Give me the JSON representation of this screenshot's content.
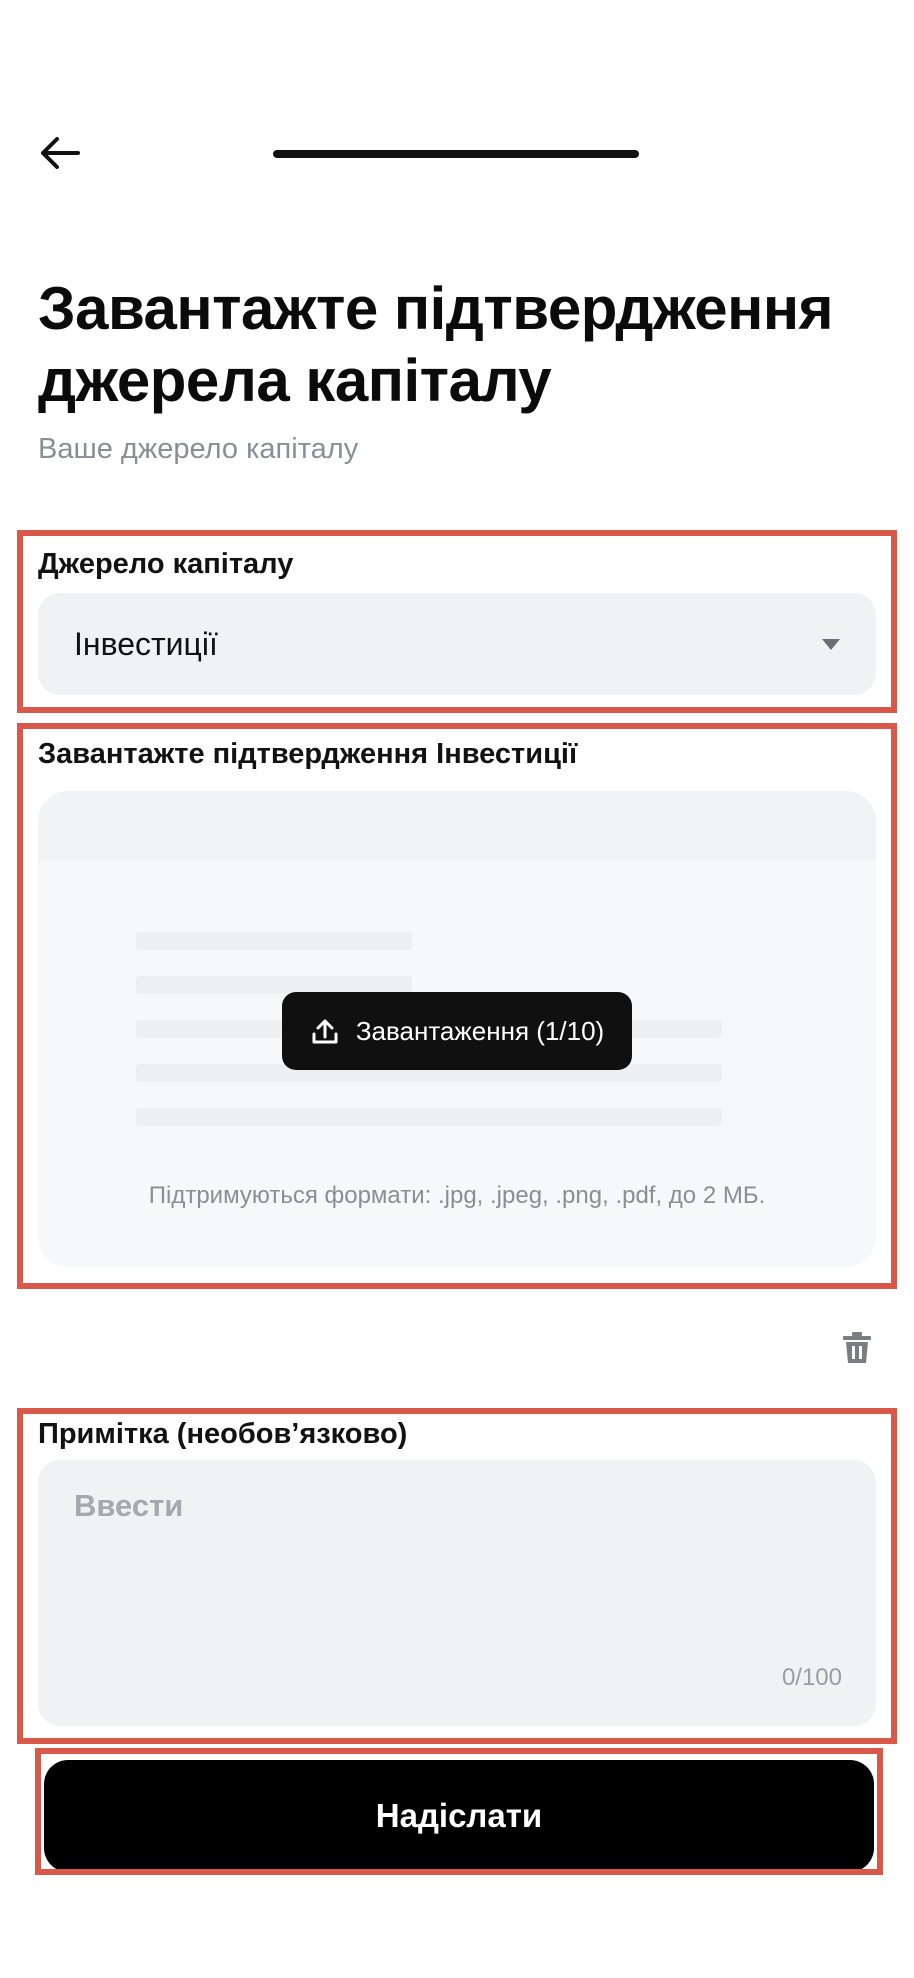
{
  "header": {
    "back_icon": "arrow-left-icon"
  },
  "title": "Завантажте підтвердження джерела капіталу",
  "subtitle": "Ваше джерело капіталу",
  "source_field": {
    "label": "Джерело капіталу",
    "selected_value": "Інвестиції",
    "icon": "caret-down-icon"
  },
  "upload": {
    "label": "Завантажте підтвердження Інвестиції",
    "button_label": "Завантаження (1/10)",
    "button_icon": "upload-icon",
    "formats_note": "Підтримуються формати: .jpg, .jpeg, .png, .pdf, до 2 МБ.",
    "delete_icon": "trash-icon"
  },
  "note": {
    "label": "Примітка (необов’язково)",
    "placeholder": "Ввести",
    "value": "",
    "counter": "0/100"
  },
  "submit_label": "Надіслати",
  "colors": {
    "highlight": "#d9584a",
    "primary_button": "#000000",
    "field_background": "#f1f2f4"
  }
}
